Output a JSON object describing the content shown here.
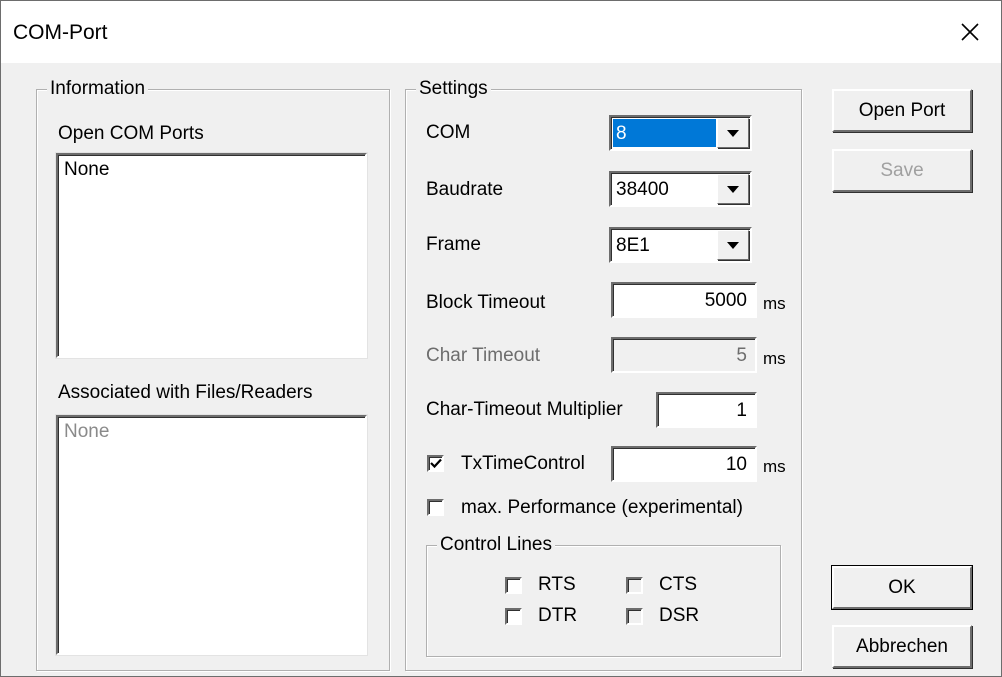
{
  "window": {
    "title": "COM-Port"
  },
  "information": {
    "legend": "Information",
    "open_ports_label": "Open COM Ports",
    "open_ports_items": [
      "None"
    ],
    "associated_label": "Associated with Files/Readers",
    "associated_items": [
      "None"
    ]
  },
  "settings": {
    "legend": "Settings",
    "com": {
      "label": "COM",
      "value": "8"
    },
    "baudrate": {
      "label": "Baudrate",
      "value": "38400"
    },
    "frame": {
      "label": "Frame",
      "value": "8E1"
    },
    "block_timeout": {
      "label": "Block Timeout",
      "value": "5000",
      "unit": "ms"
    },
    "char_timeout": {
      "label": "Char Timeout",
      "value": "5",
      "unit": "ms"
    },
    "char_timeout_multiplier": {
      "label": "Char-Timeout Multiplier",
      "value": "1"
    },
    "tx_time_control": {
      "label": "TxTimeControl",
      "checked": true,
      "value": "10",
      "unit": "ms"
    },
    "max_performance": {
      "label": "max. Performance (experimental)",
      "checked": false
    },
    "control_lines": {
      "legend": "Control Lines",
      "rts": {
        "label": "RTS",
        "checked": false
      },
      "cts": {
        "label": "CTS",
        "checked": false
      },
      "dtr": {
        "label": "DTR",
        "checked": false
      },
      "dsr": {
        "label": "DSR",
        "checked": false
      }
    }
  },
  "buttons": {
    "open_port": "Open Port",
    "save": "Save",
    "ok": "OK",
    "cancel": "Abbrechen"
  },
  "icons": {
    "close": "close-icon",
    "dropdown": "chevron-down-icon",
    "check": "checkmark-icon"
  },
  "colors": {
    "selection": "#0078d7",
    "face": "#f0f0f0",
    "disabled_text": "#6d6d6d"
  }
}
